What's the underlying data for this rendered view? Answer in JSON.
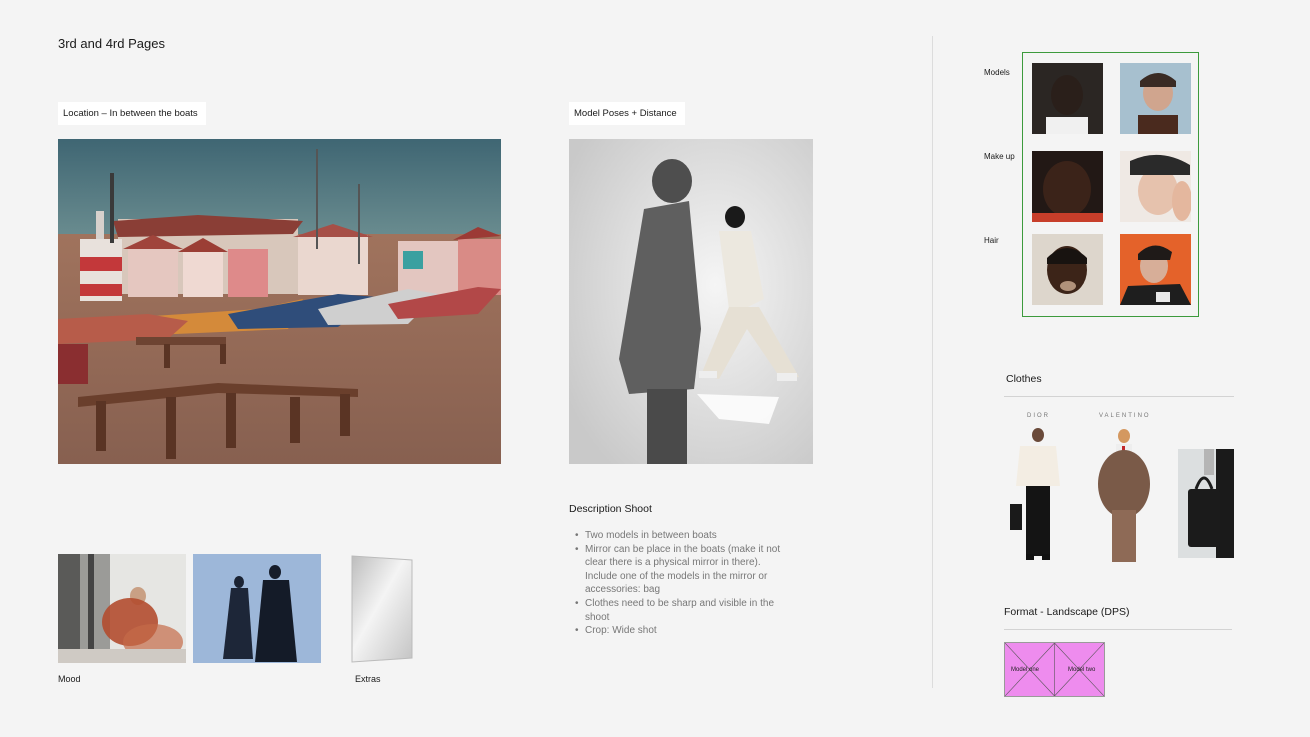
{
  "page": {
    "title": "3rd and 4rd Pages"
  },
  "location": {
    "label": "Location – In between the boats"
  },
  "poses": {
    "label": "Model Poses + Distance"
  },
  "description": {
    "title": "Description Shoot",
    "items": [
      "Two models in between boats",
      "Mirror can be place in the boats (make it not clear there is a physical  mirror in there). Include one of the models in the mirror or accessories: bag",
      "Clothes need to be sharp and visible in the shoot",
      "Crop: Wide shot"
    ]
  },
  "mood": {
    "caption": "Mood"
  },
  "extras": {
    "caption": "Extras"
  },
  "references": {
    "models_label": "Models",
    "makeup_label": "Make up",
    "hair_label": "Hair",
    "frame_color": "#3c9a3c"
  },
  "clothes": {
    "heading": "Clothes",
    "brand_1": "DIOR",
    "brand_2": "VALENTINO"
  },
  "format": {
    "heading": "Format - Landscape (DPS)",
    "left_label": "Model one",
    "right_label": "Model two",
    "fill_color": "#ee8cee"
  }
}
